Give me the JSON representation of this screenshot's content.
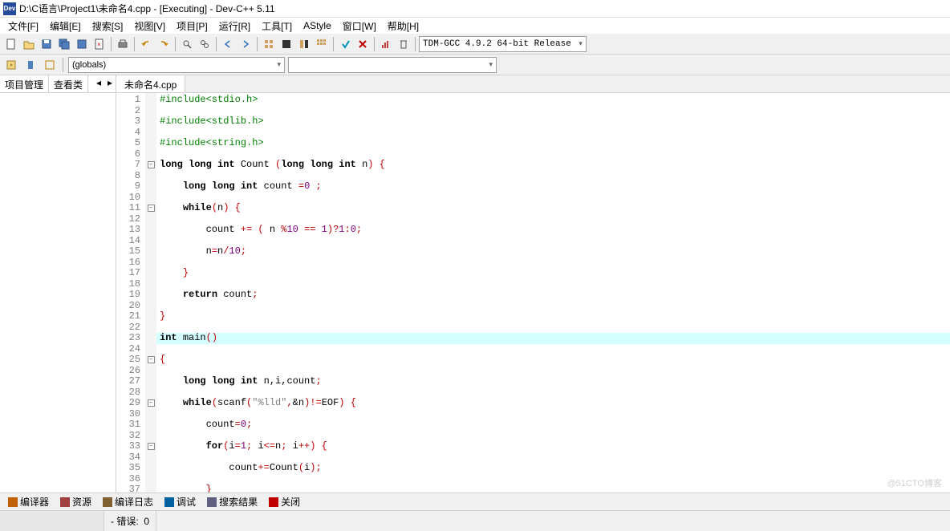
{
  "title": "D:\\C语言\\Project1\\未命名4.cpp - [Executing] - Dev-C++ 5.11",
  "menus": [
    "文件[F]",
    "编辑[E]",
    "搜索[S]",
    "视图[V]",
    "项目[P]",
    "运行[R]",
    "工具[T]",
    "AStyle",
    "窗口[W]",
    "帮助[H]"
  ],
  "compiler": "TDM-GCC 4.9.2 64-bit Release",
  "globals": "(globals)",
  "sidetabs": [
    "项目管理",
    "查看类"
  ],
  "filetab": "未命名4.cpp",
  "lines": [
    {
      "n": 1,
      "f": "",
      "t": [
        {
          "c": "pp",
          "s": "#include<stdio.h>"
        }
      ]
    },
    {
      "n": 2,
      "f": "",
      "t": []
    },
    {
      "n": 3,
      "f": "",
      "t": [
        {
          "c": "pp",
          "s": "#include<stdlib.h>"
        }
      ]
    },
    {
      "n": 4,
      "f": "",
      "t": []
    },
    {
      "n": 5,
      "f": "",
      "t": [
        {
          "c": "pp",
          "s": "#include<string.h>"
        }
      ]
    },
    {
      "n": 6,
      "f": "",
      "t": []
    },
    {
      "n": 7,
      "f": "-",
      "t": [
        {
          "c": "kw",
          "s": "long long int "
        },
        {
          "c": "func",
          "s": "Count "
        },
        {
          "c": "op",
          "s": "("
        },
        {
          "c": "kw",
          "s": "long long int "
        },
        {
          "c": "",
          "s": "n"
        },
        {
          "c": "op",
          "s": ") {"
        }
      ]
    },
    {
      "n": 8,
      "f": "",
      "t": []
    },
    {
      "n": 9,
      "f": "",
      "t": [
        {
          "c": "",
          "s": "    "
        },
        {
          "c": "kw",
          "s": "long long int "
        },
        {
          "c": "",
          "s": "count "
        },
        {
          "c": "op",
          "s": "="
        },
        {
          "c": "num",
          "s": "0"
        },
        {
          "c": "",
          "s": " "
        },
        {
          "c": "op",
          "s": ";"
        }
      ]
    },
    {
      "n": 10,
      "f": "",
      "t": []
    },
    {
      "n": 11,
      "f": "-",
      "t": [
        {
          "c": "",
          "s": "    "
        },
        {
          "c": "kw",
          "s": "while"
        },
        {
          "c": "op",
          "s": "("
        },
        {
          "c": "",
          "s": "n"
        },
        {
          "c": "op",
          "s": ") {"
        }
      ]
    },
    {
      "n": 12,
      "f": "",
      "t": []
    },
    {
      "n": 13,
      "f": "",
      "t": [
        {
          "c": "",
          "s": "        count "
        },
        {
          "c": "op",
          "s": "+= ( "
        },
        {
          "c": "",
          "s": "n "
        },
        {
          "c": "op",
          "s": "%"
        },
        {
          "c": "num",
          "s": "10"
        },
        {
          "c": "op",
          "s": " == "
        },
        {
          "c": "num",
          "s": "1"
        },
        {
          "c": "op",
          "s": ")?"
        },
        {
          "c": "num",
          "s": "1"
        },
        {
          "c": "op",
          "s": ":"
        },
        {
          "c": "num",
          "s": "0"
        },
        {
          "c": "op",
          "s": ";"
        }
      ]
    },
    {
      "n": 14,
      "f": "",
      "t": []
    },
    {
      "n": 15,
      "f": "",
      "t": [
        {
          "c": "",
          "s": "        n"
        },
        {
          "c": "op",
          "s": "="
        },
        {
          "c": "",
          "s": "n"
        },
        {
          "c": "op",
          "s": "/"
        },
        {
          "c": "num",
          "s": "10"
        },
        {
          "c": "op",
          "s": ";"
        }
      ]
    },
    {
      "n": 16,
      "f": "",
      "t": []
    },
    {
      "n": 17,
      "f": "",
      "t": [
        {
          "c": "",
          "s": "    "
        },
        {
          "c": "op",
          "s": "}"
        }
      ]
    },
    {
      "n": 18,
      "f": "",
      "t": []
    },
    {
      "n": 19,
      "f": "",
      "t": [
        {
          "c": "",
          "s": "    "
        },
        {
          "c": "kw",
          "s": "return "
        },
        {
          "c": "",
          "s": "count"
        },
        {
          "c": "op",
          "s": ";"
        }
      ]
    },
    {
      "n": 20,
      "f": "",
      "t": []
    },
    {
      "n": 21,
      "f": "",
      "t": [
        {
          "c": "op",
          "s": "}"
        }
      ]
    },
    {
      "n": 22,
      "f": "",
      "t": []
    },
    {
      "n": 23,
      "f": "",
      "hl": true,
      "t": [
        {
          "c": "kw",
          "s": "int "
        },
        {
          "c": "",
          "s": "main"
        },
        {
          "c": "op",
          "s": "()"
        }
      ]
    },
    {
      "n": 24,
      "f": "",
      "t": []
    },
    {
      "n": 25,
      "f": "-",
      "t": [
        {
          "c": "op",
          "s": "{"
        }
      ]
    },
    {
      "n": 26,
      "f": "",
      "t": []
    },
    {
      "n": 27,
      "f": "",
      "t": [
        {
          "c": "",
          "s": "    "
        },
        {
          "c": "kw",
          "s": "long long int "
        },
        {
          "c": "",
          "s": "n,i,count"
        },
        {
          "c": "op",
          "s": ";"
        }
      ]
    },
    {
      "n": 28,
      "f": "",
      "t": []
    },
    {
      "n": 29,
      "f": "-",
      "t": [
        {
          "c": "",
          "s": "    "
        },
        {
          "c": "kw",
          "s": "while"
        },
        {
          "c": "op",
          "s": "("
        },
        {
          "c": "",
          "s": "scanf"
        },
        {
          "c": "op",
          "s": "("
        },
        {
          "c": "str",
          "s": "\"%lld\""
        },
        {
          "c": "op",
          "s": ","
        },
        {
          "c": "",
          "s": "&n"
        },
        {
          "c": "op",
          "s": ")!="
        },
        {
          "c": "",
          "s": "EOF"
        },
        {
          "c": "op",
          "s": ") {"
        }
      ]
    },
    {
      "n": 30,
      "f": "",
      "t": []
    },
    {
      "n": 31,
      "f": "",
      "t": [
        {
          "c": "",
          "s": "        count"
        },
        {
          "c": "op",
          "s": "="
        },
        {
          "c": "num",
          "s": "0"
        },
        {
          "c": "op",
          "s": ";"
        }
      ]
    },
    {
      "n": 32,
      "f": "",
      "t": []
    },
    {
      "n": 33,
      "f": "-",
      "t": [
        {
          "c": "",
          "s": "        "
        },
        {
          "c": "kw",
          "s": "for"
        },
        {
          "c": "op",
          "s": "("
        },
        {
          "c": "",
          "s": "i"
        },
        {
          "c": "op",
          "s": "="
        },
        {
          "c": "num",
          "s": "1"
        },
        {
          "c": "op",
          "s": "; "
        },
        {
          "c": "",
          "s": "i"
        },
        {
          "c": "op",
          "s": "<="
        },
        {
          "c": "",
          "s": "n"
        },
        {
          "c": "op",
          "s": "; "
        },
        {
          "c": "",
          "s": "i"
        },
        {
          "c": "op",
          "s": "++) {"
        }
      ]
    },
    {
      "n": 34,
      "f": "",
      "t": []
    },
    {
      "n": 35,
      "f": "",
      "t": [
        {
          "c": "",
          "s": "            count"
        },
        {
          "c": "op",
          "s": "+="
        },
        {
          "c": "",
          "s": "Count"
        },
        {
          "c": "op",
          "s": "("
        },
        {
          "c": "",
          "s": "i"
        },
        {
          "c": "op",
          "s": ");"
        }
      ]
    },
    {
      "n": 36,
      "f": "",
      "t": []
    },
    {
      "n": 37,
      "f": "",
      "t": [
        {
          "c": "",
          "s": "        "
        },
        {
          "c": "op",
          "s": "}"
        }
      ]
    }
  ],
  "bottom_tabs": [
    {
      "icon": "#c06000",
      "label": "编译器"
    },
    {
      "icon": "#a04040",
      "label": "资源"
    },
    {
      "icon": "#806030",
      "label": "编译日志"
    },
    {
      "icon": "#0060a0",
      "label": "调试"
    },
    {
      "icon": "#606080",
      "label": "搜索结果"
    },
    {
      "icon": "#c00000",
      "label": "关闭"
    }
  ],
  "status_error_label": "- 错误:",
  "status_error_value": "0",
  "watermark": "@51CTO博客"
}
